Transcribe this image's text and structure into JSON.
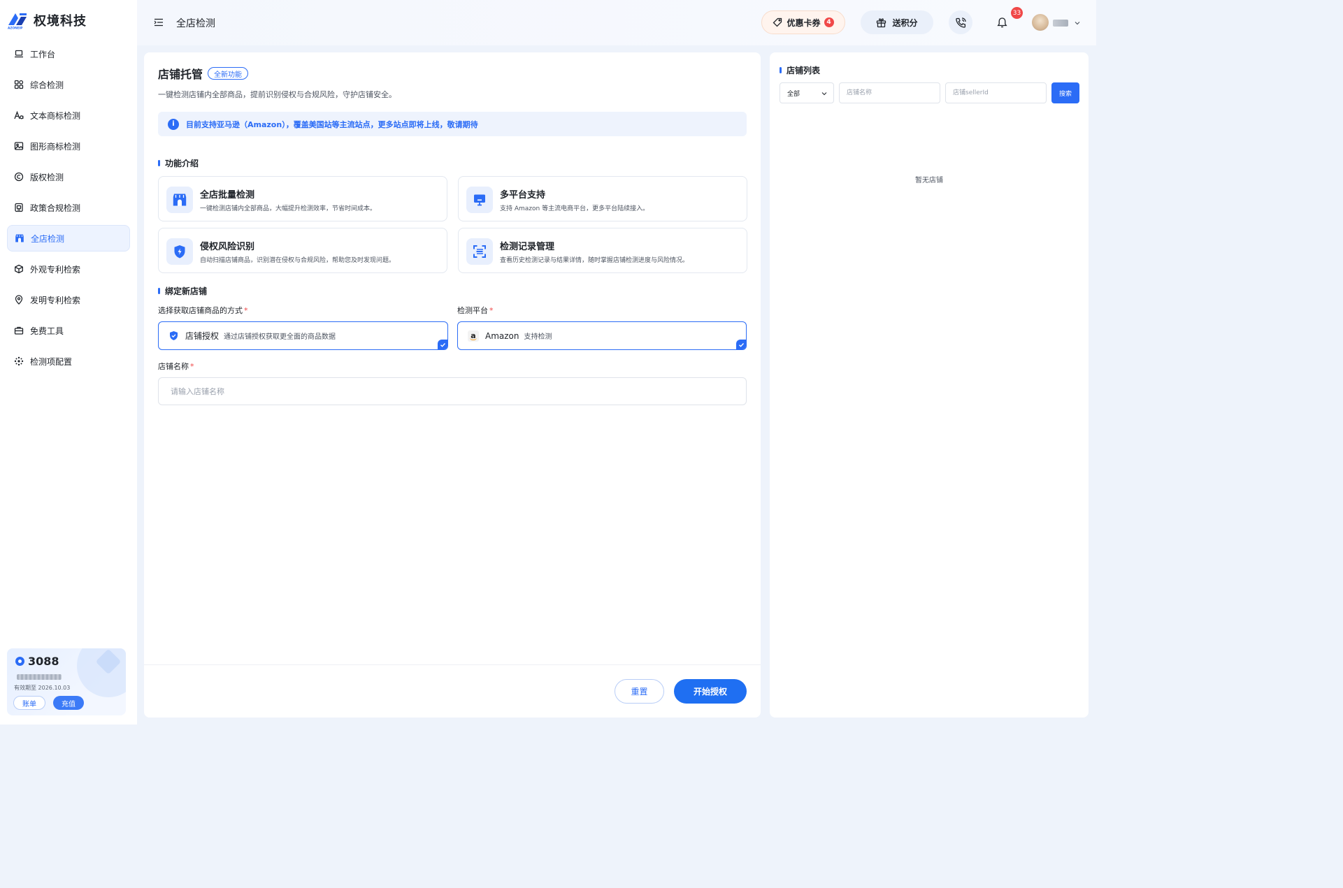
{
  "brand": {
    "name": "权境科技",
    "sub": "AZONEIP"
  },
  "sidebar": {
    "items": [
      {
        "label": "工作台",
        "icon": "laptop-icon",
        "active": false
      },
      {
        "label": "综合检测",
        "icon": "grid-icon",
        "active": false
      },
      {
        "label": "文本商标检测",
        "icon": "text-aa-icon",
        "active": false
      },
      {
        "label": "图形商标检测",
        "icon": "image-icon",
        "active": false
      },
      {
        "label": "版权检测",
        "icon": "copyright-icon",
        "active": false
      },
      {
        "label": "政策合规检测",
        "icon": "policy-icon",
        "active": false
      },
      {
        "label": "全店检测",
        "icon": "store-icon",
        "active": true
      },
      {
        "label": "外观专利检索",
        "icon": "cube-icon",
        "active": false
      },
      {
        "label": "发明专利检索",
        "icon": "lightbulb-icon",
        "active": false
      },
      {
        "label": "免费工具",
        "icon": "toolbox-icon",
        "active": false
      },
      {
        "label": "检测项配置",
        "icon": "settings-icon",
        "active": false
      }
    ]
  },
  "credits": {
    "amount": "3088",
    "expiry": "有效期至 2026.10.03",
    "bill_label": "账单",
    "recharge_label": "充值"
  },
  "header": {
    "title": "全店检测",
    "coupon_label": "优惠卡券",
    "coupon_count": "4",
    "points_label": "送积分",
    "notification_count": "33"
  },
  "main": {
    "title": "店铺托管",
    "new_tag": "全新功能",
    "description": "一键检测店铺内全部商品，提前识别侵权与合规风险，守护店铺安全。",
    "info_notice": "目前支持亚马逊（Amazon），覆盖美国站等主流站点，更多站点即将上线，敬请期待",
    "features_title": "功能介绍",
    "features": [
      {
        "title": "全店批量检测",
        "desc": "一键检测店铺内全部商品，大幅提升检测效率，节省时间成本。",
        "icon": "store-icon"
      },
      {
        "title": "多平台支持",
        "desc": "支持 Amazon 等主流电商平台，更多平台陆续接入。",
        "icon": "monitor-icon"
      },
      {
        "title": "侵权风险识别",
        "desc": "自动扫描店铺商品，识别潜在侵权与合规风险，帮助您及时发现问题。",
        "icon": "shield-bolt-icon"
      },
      {
        "title": "检测记录管理",
        "desc": "查看历史检测记录与结果详情，随时掌握店铺检测进度与风险情况。",
        "icon": "scan-frame-icon"
      }
    ],
    "bind_title": "绑定新店铺",
    "method_label": "选择获取店铺商品的方式",
    "method_option": {
      "title": "店铺授权",
      "desc": "通过店铺授权获取更全面的商品数据"
    },
    "platform_label": "检测平台",
    "platform_option": {
      "title": "Amazon",
      "desc": "支持检测"
    },
    "store_name_label": "店铺名称",
    "store_name_placeholder": "请输入店铺名称",
    "reset_label": "重置",
    "start_label": "开始授权"
  },
  "store_list": {
    "title": "店铺列表",
    "filter_value": "全部",
    "name_placeholder": "店铺名称",
    "seller_placeholder": "店铺sellerId",
    "search_label": "搜索",
    "empty_text": "暂无店铺"
  },
  "colors": {
    "accent": "#2b6cf6",
    "danger": "#f04848"
  }
}
